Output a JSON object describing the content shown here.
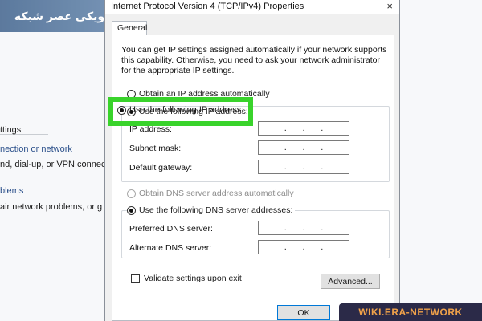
{
  "background": {
    "items": [
      {
        "text": "ttings",
        "link": false
      },
      {
        "text": "nection or network",
        "link": true
      },
      {
        "text": "nd, dial-up, or VPN connec",
        "link": false
      },
      {
        "text": "blems",
        "link": true
      },
      {
        "text": "air network problems, or g",
        "link": false
      }
    ]
  },
  "watermarks": {
    "top": "ویکی عصر شبکه",
    "bottom": "WIKI.ERA-NETWORK"
  },
  "dialog": {
    "title": "Internet Protocol Version 4 (TCP/IPv4) Properties",
    "close_glyph": "×",
    "tab": "General",
    "description": "You can get IP settings assigned automatically if your network supports this capability. Otherwise, you need to ask your network administrator for the appropriate IP settings.",
    "ip_auto": "Obtain an IP address automatically",
    "ip_manual": "Use the following IP address:",
    "ip_fields": [
      {
        "label": "IP address:",
        "value": ". . ."
      },
      {
        "label": "Subnet mask:",
        "value": ". . ."
      },
      {
        "label": "Default gateway:",
        "value": ". . ."
      }
    ],
    "dns_auto": "Obtain DNS server address automatically",
    "dns_manual": "Use the following DNS server addresses:",
    "dns_fields": [
      {
        "label": "Preferred DNS server:",
        "value": ". . ."
      },
      {
        "label": "Alternate DNS server:",
        "value": ". . ."
      }
    ],
    "validate": "Validate settings upon exit",
    "advanced": "Advanced...",
    "ok": "OK"
  },
  "colors": {
    "highlight": "#39d32b",
    "watermark_bg": "#2b2a48",
    "watermark_text": "#f0a24a"
  }
}
